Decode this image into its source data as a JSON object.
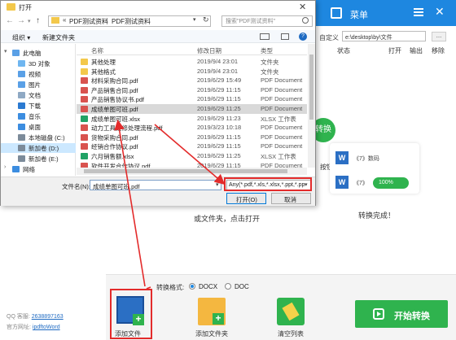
{
  "app": {
    "menu_label": "菜单",
    "custom_label": "自定义",
    "output_path": "e:\\desktop\\by\\文件",
    "columns": [
      "状态",
      "打开",
      "输出",
      "移除"
    ],
    "convert_badge": "转换",
    "button_hint": "按钮",
    "doc_card_text": "《7》数码",
    "doc_card_text2": "《7》",
    "progress_text": "100%",
    "done_text": "转换完成！",
    "left_hint": "或文件夹，点击打开",
    "format_label": "转换格式:",
    "format_options": [
      "DOCX",
      "DOC"
    ],
    "format_selected": "DOCX",
    "tools": {
      "add_file": "添加文件",
      "add_folder": "添加文件夹",
      "clear_list": "清空列表"
    },
    "start_button": "开始转换",
    "qq_label": "QQ 客服:",
    "qq_value": "2638897163",
    "site_label": "官方网址:",
    "site_value": "ipdftoWord"
  },
  "dialog": {
    "title": "打开",
    "breadcrumb": [
      "PDF测试资料",
      "PDF测试资料"
    ],
    "search_placeholder": "搜索\"PDF测试资料\"",
    "organize": "组织 ▾",
    "new_folder": "新建文件夹",
    "tree": [
      {
        "label": "此电脑",
        "icon": "computer-icon",
        "color": "#5aa0e6"
      },
      {
        "label": "3D 对象",
        "icon": "3d-objects-icon",
        "color": "#6fb6f0"
      },
      {
        "label": "视频",
        "icon": "video-icon",
        "color": "#5aa0e6"
      },
      {
        "label": "图片",
        "icon": "pictures-icon",
        "color": "#5aa0e6"
      },
      {
        "label": "文档",
        "icon": "documents-icon",
        "color": "#8fa9c4"
      },
      {
        "label": "下载",
        "icon": "downloads-icon",
        "color": "#2b7ad1"
      },
      {
        "label": "音乐",
        "icon": "music-icon",
        "color": "#3c8de0"
      },
      {
        "label": "桌面",
        "icon": "desktop-icon",
        "color": "#3c8de0"
      },
      {
        "label": "本地磁盘 (C:)",
        "icon": "drive-icon",
        "color": "#7c8b9a"
      },
      {
        "label": "新加卷 (D:)",
        "icon": "drive-icon",
        "color": "#7c8b9a"
      },
      {
        "label": "新加卷 (E:)",
        "icon": "drive-icon",
        "color": "#7c8b9a"
      },
      {
        "label": "网络",
        "icon": "network-icon",
        "color": "#3c8de0"
      }
    ],
    "list_headers": [
      "名称",
      "修改日期",
      "类型"
    ],
    "files": [
      {
        "name": "其他处理",
        "date": "2019/9/4 23:01",
        "type": "文件夹",
        "kind": "folder"
      },
      {
        "name": "其他格式",
        "date": "2019/9/4 23:01",
        "type": "文件夹",
        "kind": "folder"
      },
      {
        "name": "材料采购合同.pdf",
        "date": "2019/6/29 15:49",
        "type": "PDF Document",
        "kind": "pdf"
      },
      {
        "name": "产品销售合同.pdf",
        "date": "2019/6/29 11:15",
        "type": "PDF Document",
        "kind": "pdf"
      },
      {
        "name": "产品销售协议书.pdf",
        "date": "2019/6/29 11:15",
        "type": "PDF Document",
        "kind": "pdf"
      },
      {
        "name": "成绩单图可班.pdf",
        "date": "2019/6/29 11:25",
        "type": "PDF Document",
        "kind": "pdf"
      },
      {
        "name": "成绩单图可班.xlsx",
        "date": "2019/6/29 11:23",
        "type": "XLSX 工作表",
        "kind": "xlsx"
      },
      {
        "name": "动力工具维修处理流程.pdf",
        "date": "2019/3/23 10:18",
        "type": "PDF Document",
        "kind": "pdf"
      },
      {
        "name": "货物采购合同.pdf",
        "date": "2019/6/29 11:15",
        "type": "PDF Document",
        "kind": "pdf"
      },
      {
        "name": "经销合作协议.pdf",
        "date": "2019/6/29 11:15",
        "type": "PDF Document",
        "kind": "pdf"
      },
      {
        "name": "六月销售额.xlsx",
        "date": "2019/6/29 11:25",
        "type": "XLSX 工作表",
        "kind": "xlsx"
      },
      {
        "name": "软件开发合作协议.pdf",
        "date": "2019/6/29 11:15",
        "type": "PDF Document",
        "kind": "pdf"
      }
    ],
    "filename_label": "文件名(N):",
    "filename_value": "成绩单图可班.pdf",
    "filter_value": "Any(*.pdf,*.xls,*.xlsx,*.ppt,*.pp",
    "open_button": "打开(O)",
    "cancel_button": "取消",
    "colors": {
      "selected_tree": "#cce8ff",
      "highlight_row": "#d9d9d9",
      "annotation": "#e32b2b"
    }
  }
}
